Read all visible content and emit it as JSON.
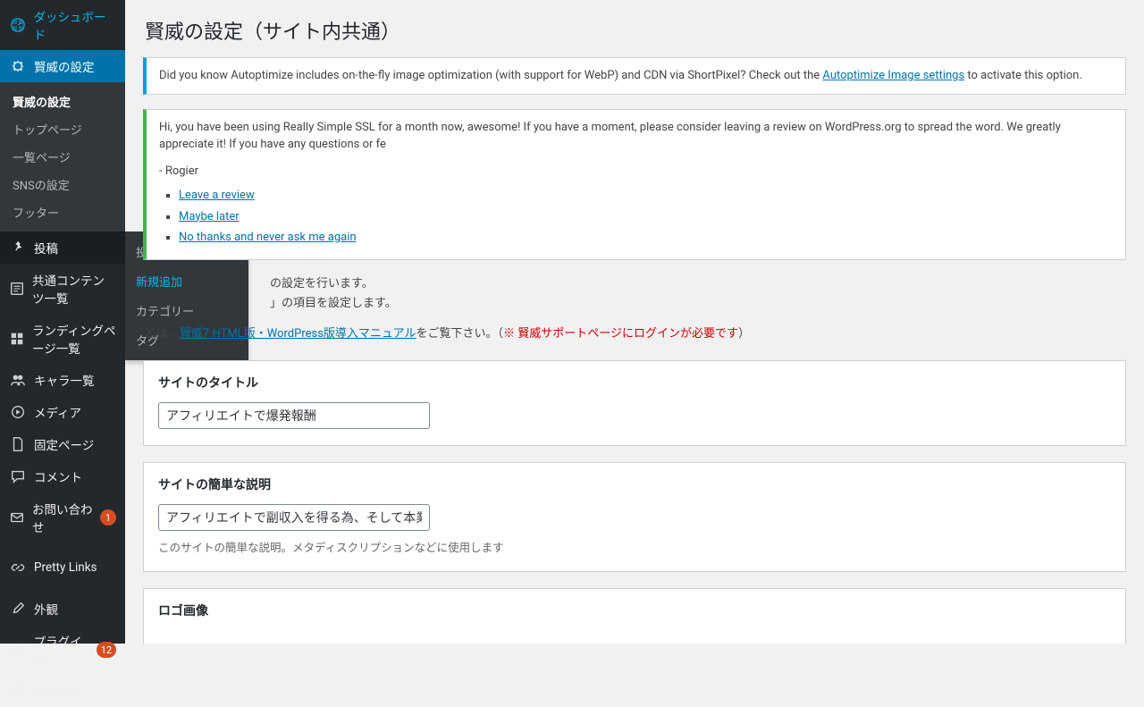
{
  "sidebar": {
    "dashboard": "ダッシュボード",
    "keni": "賢威の設定",
    "keni_sub": {
      "settings": "賢威の設定",
      "toppage": "トップページ",
      "listpage": "一覧ページ",
      "sns": "SNSの設定",
      "footer": "フッター"
    },
    "posts": "投稿",
    "common_content": "共通コンテンツ一覧",
    "landing": "ランディングページ一覧",
    "chara": "キャラ一覧",
    "media": "メディア",
    "pages": "固定ページ",
    "comments": "コメント",
    "contact": "お問い合わせ",
    "contact_badge": "1",
    "prettylinks": "Pretty Links",
    "appearance": "外観",
    "plugins": "プラグイン",
    "plugins_badge": "12",
    "users": "ユーザー"
  },
  "flyout": {
    "list": "投稿一覧",
    "new": "新規追加",
    "categories": "カテゴリー",
    "tags": "タグ"
  },
  "page": {
    "title": "賢威の設定（サイト内共通）"
  },
  "notices": {
    "autoptimize_before": "Did you know Autoptimize includes on-the-fly image optimization (with support for WebP) and CDN via ShortPixel? Check out the ",
    "autoptimize_link": "Autoptimize Image settings",
    "autoptimize_after": " to activate this option.",
    "rsssl_text": "Hi, you have been using Really Simple SSL for a month now, awesome! If you have a moment, please consider leaving a review on WordPress.org to spread the word. We greatly appreciate it! If you have any questions or fe",
    "rsssl_sign": "- Rogier",
    "rsssl_links": {
      "review": "Leave a review",
      "later": "Maybe later",
      "never": "No thanks and never ask me again"
    }
  },
  "intro": {
    "line1_suffix": "の設定を行います。",
    "line2_suffix": "」の項目を設定します。",
    "line3_before": "どは、",
    "line3_link": "賢威7 HTML版・WordPress版導入マニュアル",
    "line3_mid": "をご覧下さい。（",
    "line3_warn": "※ 賢威サポートページにログインが必要です",
    "line3_after": "）"
  },
  "panels": {
    "site_title": {
      "heading": "サイトのタイトル",
      "value": "アフィリエイトで爆発報酬"
    },
    "site_desc": {
      "heading": "サイトの簡単な説明",
      "value": "アフィリエイトで副収入を得る為、そして本業で事業",
      "help": "このサイトの簡単な説明。メタディスクリプションなどに使用します"
    },
    "logo": {
      "heading": "ロゴ画像"
    }
  }
}
